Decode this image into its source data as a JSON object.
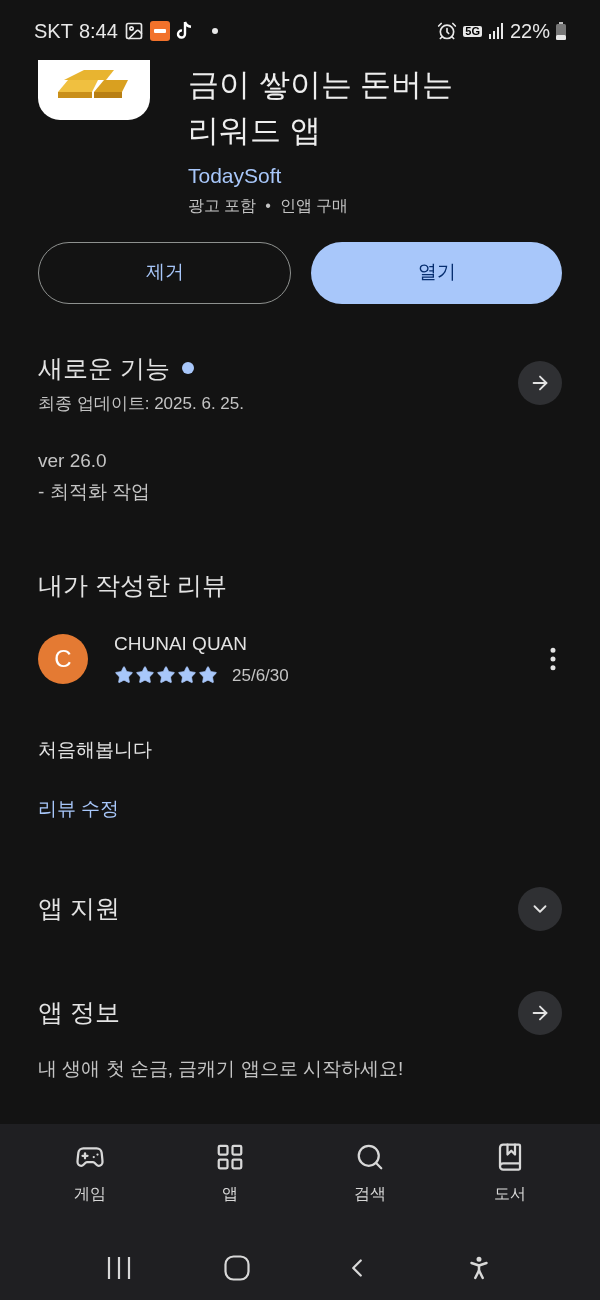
{
  "status_bar": {
    "carrier": "SKT",
    "time": "8:44",
    "network": "5G",
    "battery": "22%"
  },
  "app": {
    "title_lines": [
      "금이 쌓이는 돈버는",
      "리워드 앱"
    ],
    "developer": "TodaySoft",
    "notes": "광고 포함  •  인앱 구매"
  },
  "actions": [
    {
      "label": "제거",
      "kind": "outline"
    },
    {
      "label": "열기",
      "kind": "filled"
    }
  ],
  "whats_new": {
    "title": "새로운 기능",
    "updated": "최종 업데이트: 2025. 6. 25.",
    "lines": [
      "ver 26.0",
      "- 최적화 작업"
    ]
  },
  "my_review": {
    "title": "내가 작성한 리뷰",
    "avatar_letter": "C",
    "author": "CHUNAI QUAN",
    "stars": 5,
    "date": "25/6/30",
    "text": "처음해봅니다",
    "edit_link": "리뷰 수정"
  },
  "sections": [
    {
      "title": "앱 지원",
      "kind": "expand",
      "expanded": false
    },
    {
      "title": "앱 정보",
      "kind": "open",
      "description": "내 생애 첫 순금, 금캐기 앱으로 시작하세요!"
    }
  ],
  "bottom_nav": [
    {
      "label": "게임",
      "kind": "games",
      "selected": false
    },
    {
      "label": "앱",
      "kind": "apps",
      "selected": false
    },
    {
      "label": "검색",
      "kind": "search",
      "selected": false
    },
    {
      "label": "도서",
      "kind": "books",
      "selected": false
    }
  ]
}
